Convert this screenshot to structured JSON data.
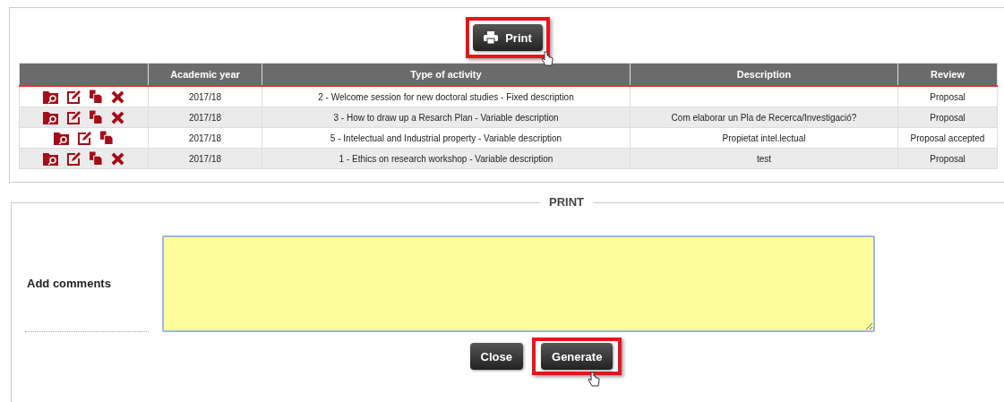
{
  "print_button": {
    "label": "Print",
    "highlighted": true
  },
  "table": {
    "columns": [
      "Academic year",
      "Type of activity",
      "Description",
      "Review"
    ],
    "rows": [
      {
        "actions": [
          {
            "kind": "view"
          },
          {
            "kind": "edit"
          },
          {
            "kind": "copy"
          },
          {
            "kind": "delete"
          }
        ],
        "cells": [
          "2017/18",
          "2 - Welcome session for new doctoral studies - Fixed description",
          "",
          "Proposal"
        ]
      },
      {
        "actions": [
          {
            "kind": "view"
          },
          {
            "kind": "edit"
          },
          {
            "kind": "copy"
          },
          {
            "kind": "delete"
          }
        ],
        "cells": [
          "2017/18",
          "3 - How to draw up a Resarch Plan - Variable description",
          "Com elaborar un Pla de Recerca/Investigació?",
          "Proposal"
        ]
      },
      {
        "actions": [
          {
            "kind": "view"
          },
          {
            "kind": "edit"
          },
          {
            "kind": "copy"
          }
        ],
        "cells": [
          "2017/18",
          "5 - Intelectual and Industrial property - Variable description",
          "Propietat intel.lectual",
          "Proposal accepted"
        ]
      },
      {
        "actions": [
          {
            "kind": "view"
          },
          {
            "kind": "edit"
          },
          {
            "kind": "copy"
          },
          {
            "kind": "delete"
          }
        ],
        "cells": [
          "2017/18",
          "1 - Ethics on research workshop - Variable description",
          "test",
          "Proposal"
        ]
      }
    ]
  },
  "print_dialog": {
    "legend": "PRINT",
    "comments_label": "Add comments",
    "buttons": [
      {
        "label": "Close",
        "highlighted": false
      },
      {
        "label": "Generate",
        "highlighted": true
      }
    ]
  }
}
